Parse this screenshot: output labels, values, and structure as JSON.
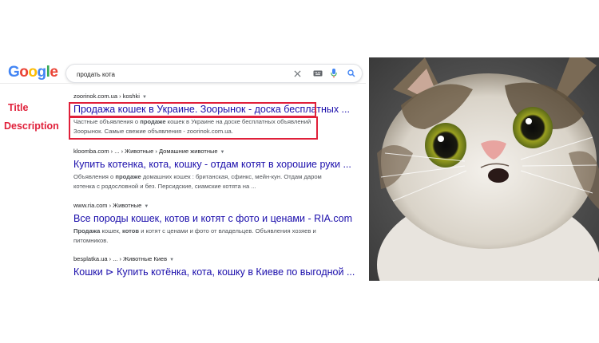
{
  "google": {
    "logo_letters": [
      {
        "ch": "G",
        "color": "#4285F4"
      },
      {
        "ch": "o",
        "color": "#EA4335"
      },
      {
        "ch": "o",
        "color": "#FBBC05"
      },
      {
        "ch": "g",
        "color": "#4285F4"
      },
      {
        "ch": "l",
        "color": "#34A853"
      },
      {
        "ch": "e",
        "color": "#EA4335"
      }
    ],
    "search_query": "продать кота"
  },
  "annotations": {
    "title_label": "Title",
    "description_label": "Description",
    "color": "#e0203a"
  },
  "results": [
    {
      "url": "zoorinok.com.ua › koshki",
      "title": "Продажа кошек в Украине. Зоорынок - доска бесплатных ...",
      "description_parts": [
        {
          "text": "Частные объявления о ",
          "bold": false
        },
        {
          "text": "продаже",
          "bold": true
        },
        {
          "text": " кошек в Украине на доске бесплатных объявлений Зоорынок. Самые свежие объявления - zoorinok.com.ua.",
          "bold": false
        }
      ]
    },
    {
      "url": "kloomba.com › ... › Животные › Домашние животные",
      "title": "Купить котенка, кота, кошку - отдам котят в хорошие руки ...",
      "description_parts": [
        {
          "text": "Объявления о ",
          "bold": false
        },
        {
          "text": "продаже",
          "bold": true
        },
        {
          "text": " домашних кошек : британская, сфинкс, мейн-кун. Отдам даром котенка с родословной и без. Персидские, сиамские котята на ...",
          "bold": false
        }
      ]
    },
    {
      "url": "www.ria.com › Животные",
      "title": "Все породы кошек, котов и котят с фото и ценами - RIA.com",
      "description_parts": [
        {
          "text": "Продажа",
          "bold": true
        },
        {
          "text": " кошек, ",
          "bold": false
        },
        {
          "text": "котов",
          "bold": true
        },
        {
          "text": " и котят с ценами и фото от владельцев. Объявления хозяев и питомников.",
          "bold": false
        }
      ]
    },
    {
      "url": "besplatka.ua › ... › Животные Киев",
      "title": "Кошки ⊳ Купить котёнка, кота, кошку в Киеве по выгодной ...",
      "description_parts": []
    }
  ]
}
